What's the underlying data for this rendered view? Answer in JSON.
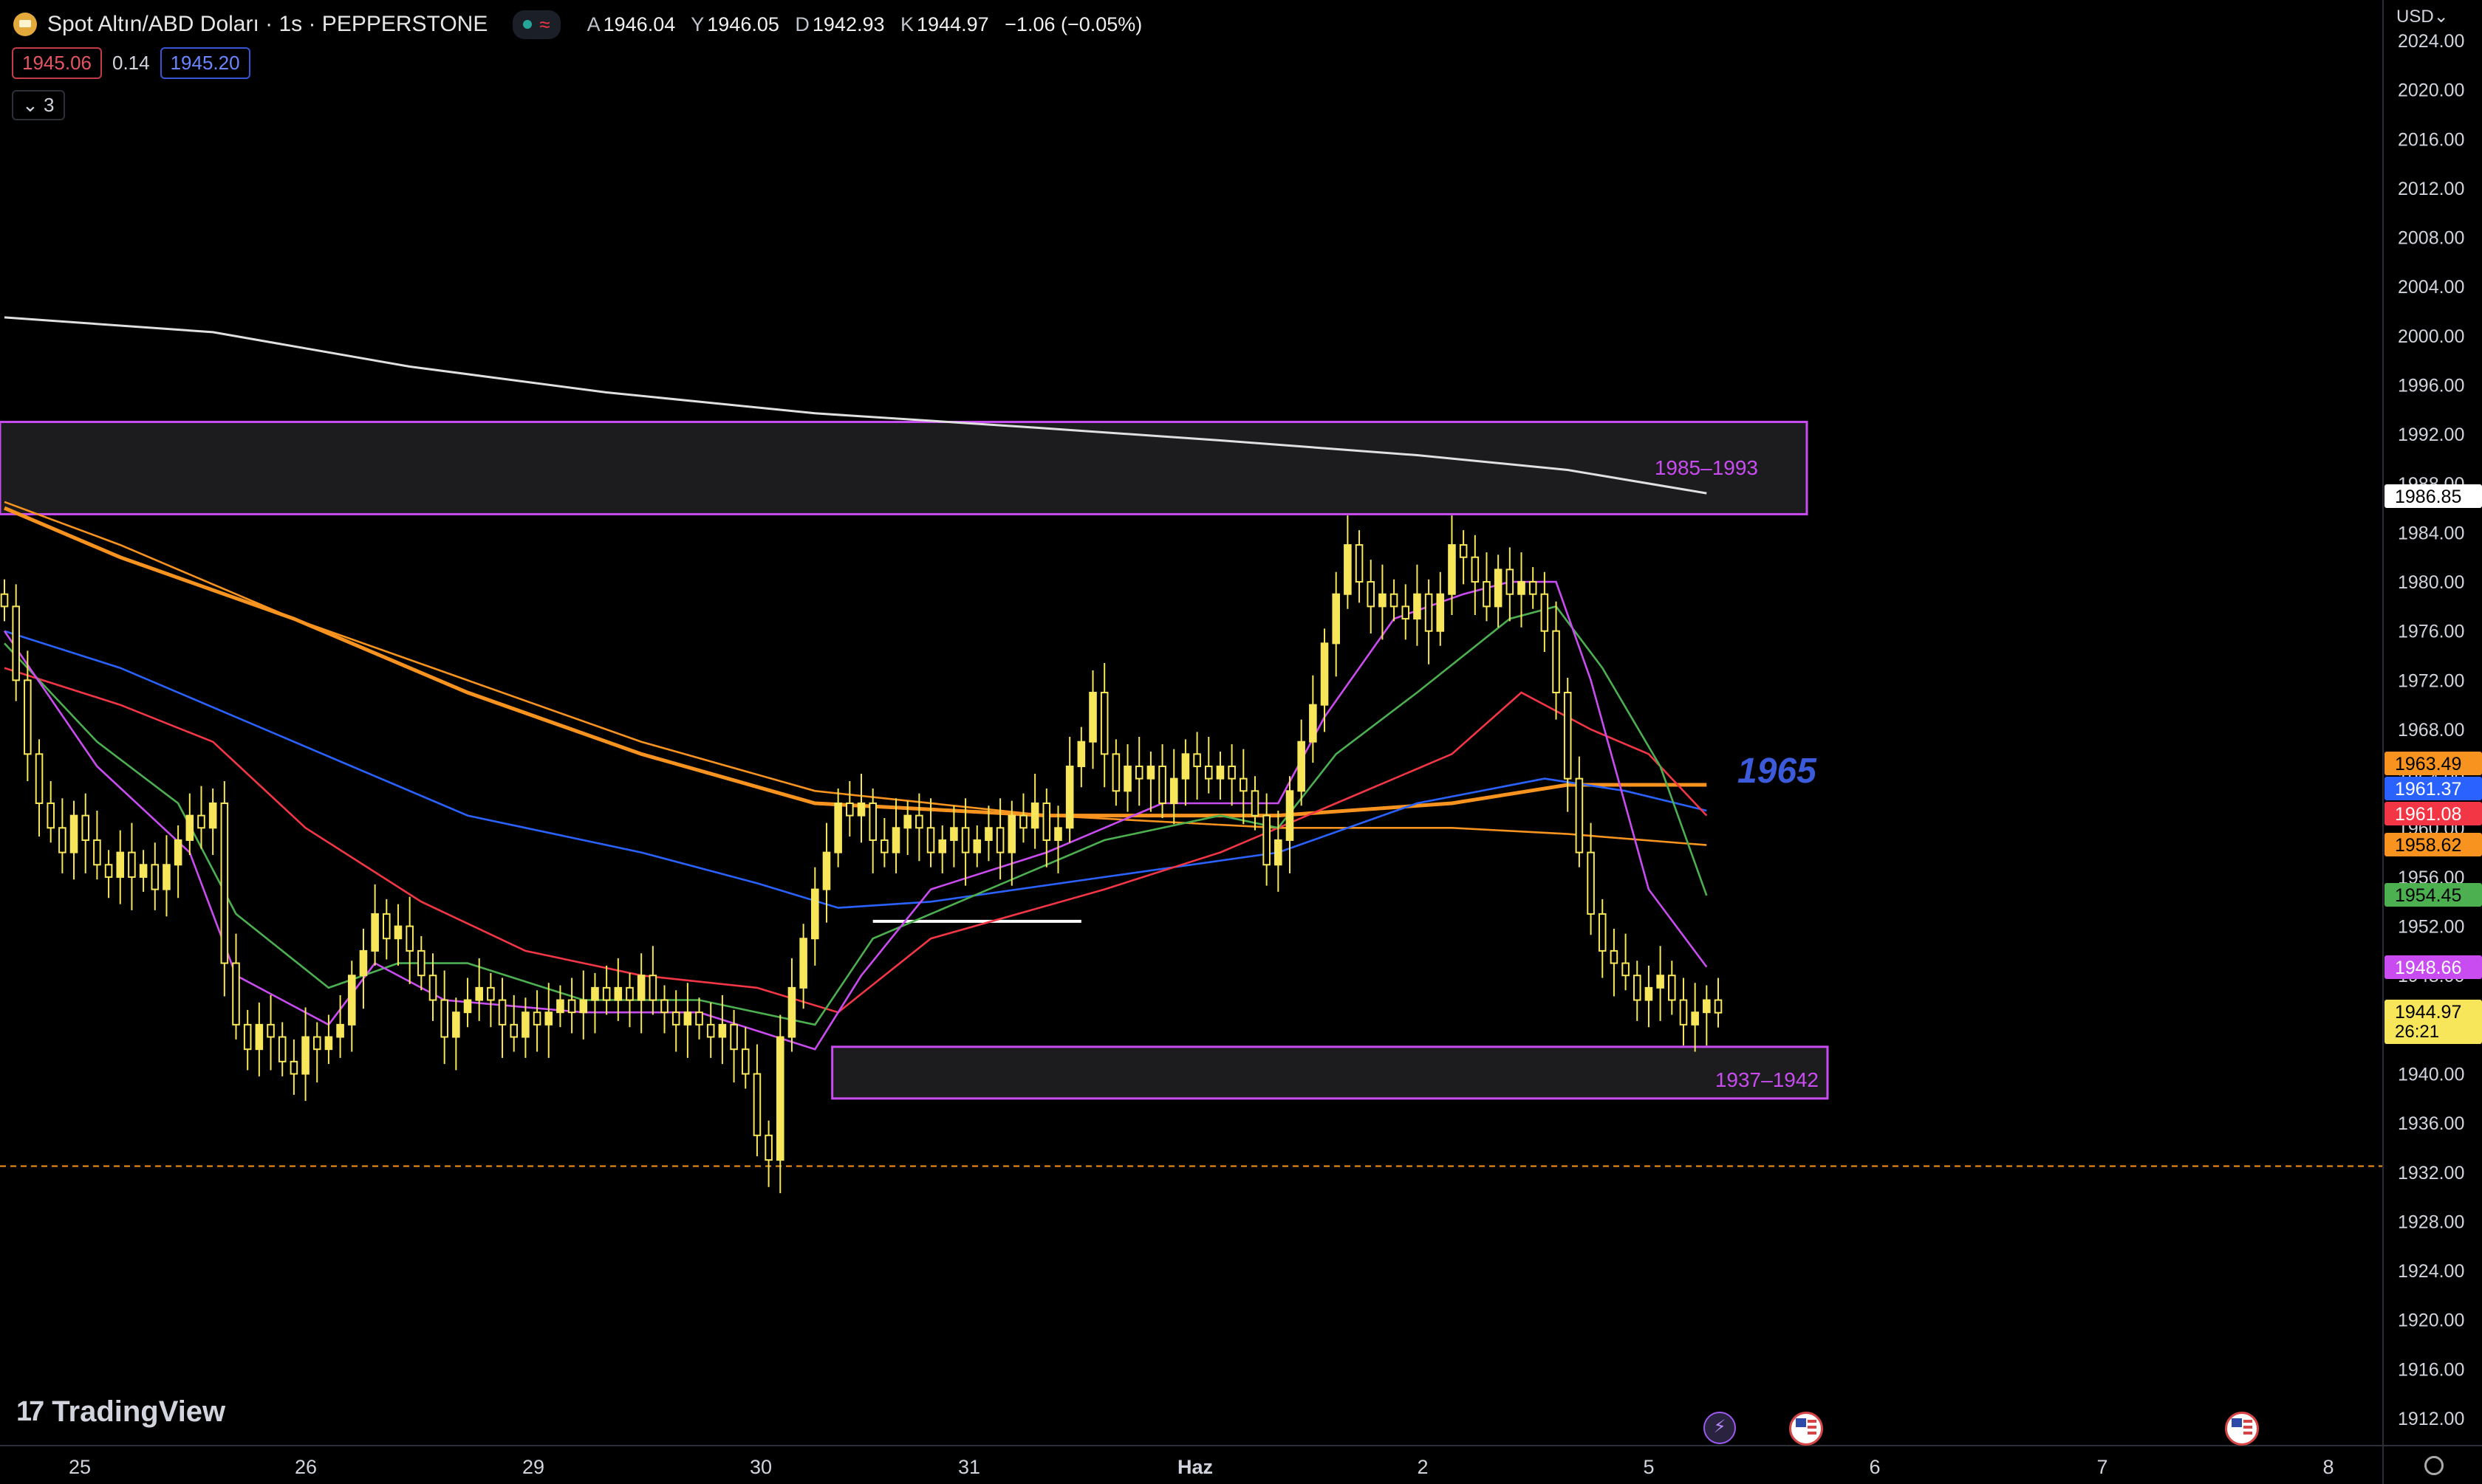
{
  "header": {
    "symbol": "Spot Altın/ABD Doları · 1s · PEPPERSTONE",
    "status_wave": "≈",
    "ohlc": [
      {
        "key": "A",
        "value": "1946.04"
      },
      {
        "key": "Y",
        "value": "1946.05"
      },
      {
        "key": "D",
        "value": "1942.93"
      },
      {
        "key": "K",
        "value": "1944.97"
      }
    ],
    "change": "−1.06 (−0.05%)",
    "sell_price": "1945.06",
    "spread": "0.14",
    "buy_price": "1945.20",
    "indicators_toggle": "3"
  },
  "currency": "USD",
  "brand": "TradingView",
  "annotations": {
    "zone_upper": "1985–1993",
    "zone_lower": "1937–1942",
    "level_text": "1965"
  },
  "colors": {
    "background": "#000000",
    "candle": "#f7e65a",
    "zone_border": "#c94cf0",
    "level_text": "#3b5bdb",
    "ema_orange": "#f7931e",
    "ema_blue": "#2962ff",
    "ema_red": "#f23645",
    "ema_green": "#4caf50",
    "ema_purple": "#c94cf0",
    "ma_white": "#e0e0e0"
  },
  "chart_data": {
    "type": "candlestick",
    "instrument": "Spot Altın/ABD Doları",
    "timeframe": "1s",
    "ylim": [
      1910,
      2025
    ],
    "y_ticks": [
      "2024.00",
      "2020.00",
      "2016.00",
      "2012.00",
      "2008.00",
      "2004.00",
      "2000.00",
      "1996.00",
      "1992.00",
      "1988.00",
      "1984.00",
      "1980.00",
      "1976.00",
      "1972.00",
      "1968.00",
      "1964.00",
      "1960.00",
      "1956.00",
      "1952.00",
      "1948.00",
      "1944.00",
      "1940.00",
      "1936.00",
      "1932.00",
      "1928.00",
      "1924.00",
      "1920.00",
      "1916.00",
      "1912.00"
    ],
    "x_ticks": [
      "25",
      "26",
      "29",
      "30",
      "31",
      "Haz",
      "2",
      "5",
      "6",
      "7",
      "8"
    ],
    "price_badges": [
      {
        "value": "1986.85",
        "color": "#ffffff",
        "text": "#000000"
      },
      {
        "value": "1963.49",
        "color": "#f7931e",
        "text": "#000000"
      },
      {
        "value": "1961.37",
        "color": "#2962ff",
        "text": "#ffffff"
      },
      {
        "value": "1961.08",
        "color": "#f23645",
        "text": "#ffffff"
      },
      {
        "value": "1958.62",
        "color": "#f7931e",
        "text": "#000000"
      },
      {
        "value": "1954.45",
        "color": "#4caf50",
        "text": "#000000"
      },
      {
        "value": "1948.66",
        "color": "#c94cf0",
        "text": "#ffffff"
      },
      {
        "value": "1944.97",
        "color": "#f7e65a",
        "text": "#000000"
      }
    ],
    "countdown": "26:21",
    "zones": [
      {
        "label": "1985–1993",
        "low": 1985.5,
        "high": 1993,
        "from_candle": 0,
        "to_candle": 160
      },
      {
        "label": "1937–1942",
        "low": 1938,
        "high": 1942.2,
        "from_candle": 72,
        "to_candle": 162
      }
    ],
    "horizontal_line_dashed": 1932.5,
    "segment_line": {
      "value": 1952.4,
      "from_candle": 75,
      "to_candle": 93
    },
    "closes": [
      1978,
      1972,
      1966,
      1962,
      1960,
      1958,
      1961,
      1959,
      1957,
      1956,
      1958,
      1956,
      1957,
      1955,
      1957,
      1959,
      1961,
      1960,
      1962,
      1949,
      1944,
      1942,
      1944,
      1943,
      1941,
      1940,
      1943,
      1942,
      1943,
      1944,
      1948,
      1950,
      1953,
      1951,
      1952,
      1950,
      1948,
      1946,
      1943,
      1945,
      1946,
      1947,
      1946,
      1944,
      1943,
      1945,
      1944,
      1945,
      1946,
      1945,
      1946,
      1947,
      1946,
      1947,
      1946,
      1948,
      1946,
      1945,
      1944,
      1945,
      1944,
      1943,
      1944,
      1942,
      1940,
      1935,
      1933,
      1943,
      1947,
      1951,
      1955,
      1958,
      1962,
      1961,
      1962,
      1959,
      1958,
      1960,
      1961,
      1960,
      1958,
      1959,
      1960,
      1958,
      1959,
      1960,
      1958,
      1961,
      1960,
      1962,
      1959,
      1960,
      1965,
      1967,
      1971,
      1966,
      1963,
      1965,
      1964,
      1965,
      1962,
      1964,
      1966,
      1965,
      1964,
      1965,
      1964,
      1963,
      1961,
      1957,
      1959,
      1963,
      1967,
      1970,
      1975,
      1979,
      1983,
      1980,
      1978,
      1979,
      1978,
      1977,
      1979,
      1976,
      1979,
      1983,
      1982,
      1980,
      1978,
      1981,
      1979,
      1980,
      1979,
      1976,
      1971,
      1964,
      1958,
      1953,
      1950,
      1949,
      1948,
      1946,
      1947,
      1948,
      1946,
      1944,
      1945,
      1946,
      1944.97
    ],
    "series": [
      {
        "name": "ma_white",
        "color": "#e0e0e0",
        "points": [
          [
            0,
            2001.5
          ],
          [
            18,
            2000.3
          ],
          [
            35,
            1997.5
          ],
          [
            52,
            1995.4
          ],
          [
            70,
            1993.7
          ],
          [
            88,
            1992.6
          ],
          [
            105,
            1991.5
          ],
          [
            122,
            1990.3
          ],
          [
            135,
            1989.1
          ],
          [
            147,
            1987.2
          ]
        ]
      },
      {
        "name": "ema_orange",
        "color": "#f7931e",
        "points": [
          [
            0,
            1986
          ],
          [
            10,
            1982
          ],
          [
            25,
            1977
          ],
          [
            40,
            1971
          ],
          [
            55,
            1966
          ],
          [
            70,
            1962
          ],
          [
            90,
            1961
          ],
          [
            110,
            1961
          ],
          [
            125,
            1962
          ],
          [
            135,
            1963.5
          ],
          [
            147,
            1963.5
          ]
        ]
      },
      {
        "name": "ema_orange_thin",
        "color": "#f7931e",
        "points": [
          [
            0,
            1986.5
          ],
          [
            10,
            1983
          ],
          [
            25,
            1977
          ],
          [
            40,
            1972
          ],
          [
            55,
            1967
          ],
          [
            70,
            1963
          ],
          [
            90,
            1961
          ],
          [
            110,
            1960
          ],
          [
            125,
            1960
          ],
          [
            135,
            1959.5
          ],
          [
            147,
            1958.6
          ]
        ]
      },
      {
        "name": "ema_blue",
        "color": "#2962ff",
        "points": [
          [
            0,
            1976
          ],
          [
            10,
            1973
          ],
          [
            20,
            1969
          ],
          [
            30,
            1965
          ],
          [
            40,
            1961
          ],
          [
            55,
            1958
          ],
          [
            65,
            1955.5
          ],
          [
            72,
            1953.5
          ],
          [
            80,
            1954
          ],
          [
            95,
            1956
          ],
          [
            110,
            1958
          ],
          [
            122,
            1962
          ],
          [
            133,
            1964
          ],
          [
            140,
            1963
          ],
          [
            147,
            1961.4
          ]
        ]
      },
      {
        "name": "ema_red",
        "color": "#f23645",
        "points": [
          [
            0,
            1973
          ],
          [
            10,
            1970
          ],
          [
            18,
            1967
          ],
          [
            26,
            1960
          ],
          [
            36,
            1954
          ],
          [
            45,
            1950
          ],
          [
            55,
            1948
          ],
          [
            65,
            1947
          ],
          [
            72,
            1945
          ],
          [
            80,
            1951
          ],
          [
            95,
            1955
          ],
          [
            105,
            1958
          ],
          [
            115,
            1962
          ],
          [
            125,
            1966
          ],
          [
            131,
            1971
          ],
          [
            137,
            1968
          ],
          [
            142,
            1966
          ],
          [
            147,
            1961
          ]
        ]
      },
      {
        "name": "ema_green",
        "color": "#4caf50",
        "points": [
          [
            0,
            1975
          ],
          [
            8,
            1967
          ],
          [
            15,
            1962
          ],
          [
            20,
            1953
          ],
          [
            28,
            1947
          ],
          [
            34,
            1949
          ],
          [
            40,
            1949
          ],
          [
            50,
            1946
          ],
          [
            60,
            1946
          ],
          [
            70,
            1944
          ],
          [
            75,
            1951
          ],
          [
            85,
            1955
          ],
          [
            95,
            1959
          ],
          [
            105,
            1961
          ],
          [
            110,
            1960
          ],
          [
            115,
            1966
          ],
          [
            122,
            1971
          ],
          [
            130,
            1977
          ],
          [
            134,
            1978
          ],
          [
            138,
            1973
          ],
          [
            143,
            1965
          ],
          [
            147,
            1954.5
          ]
        ]
      },
      {
        "name": "ema_purple",
        "color": "#c94cf0",
        "points": [
          [
            0,
            1976
          ],
          [
            8,
            1965
          ],
          [
            16,
            1958
          ],
          [
            20,
            1948
          ],
          [
            28,
            1944
          ],
          [
            32,
            1949
          ],
          [
            38,
            1946
          ],
          [
            50,
            1945
          ],
          [
            60,
            1945
          ],
          [
            70,
            1942
          ],
          [
            74,
            1948
          ],
          [
            80,
            1955
          ],
          [
            90,
            1958
          ],
          [
            100,
            1962
          ],
          [
            110,
            1962
          ],
          [
            114,
            1969
          ],
          [
            120,
            1977
          ],
          [
            126,
            1979
          ],
          [
            130,
            1980
          ],
          [
            134,
            1980
          ],
          [
            137,
            1972
          ],
          [
            142,
            1955
          ],
          [
            147,
            1948.7
          ]
        ]
      }
    ]
  }
}
